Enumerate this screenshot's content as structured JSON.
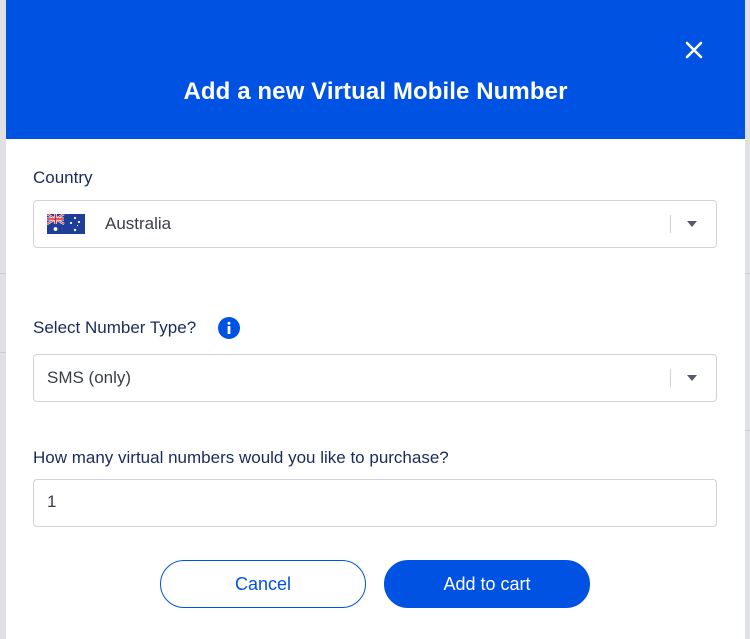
{
  "modal": {
    "title": "Add a new Virtual Mobile Number",
    "close_icon": "close-icon"
  },
  "country": {
    "label": "Country",
    "selected": "Australia",
    "flag_icon": "australia-flag-icon"
  },
  "number_type": {
    "label": "Select Number Type?",
    "info_icon": "info-icon",
    "selected": "SMS (only)"
  },
  "quantity": {
    "label": "How many virtual numbers would you like to purchase?",
    "value": "1"
  },
  "actions": {
    "cancel_label": "Cancel",
    "add_to_cart_label": "Add to cart"
  },
  "colors": {
    "brand": "#0052e2",
    "text_dark": "#1a2b5c",
    "border": "#cfd3d9"
  }
}
